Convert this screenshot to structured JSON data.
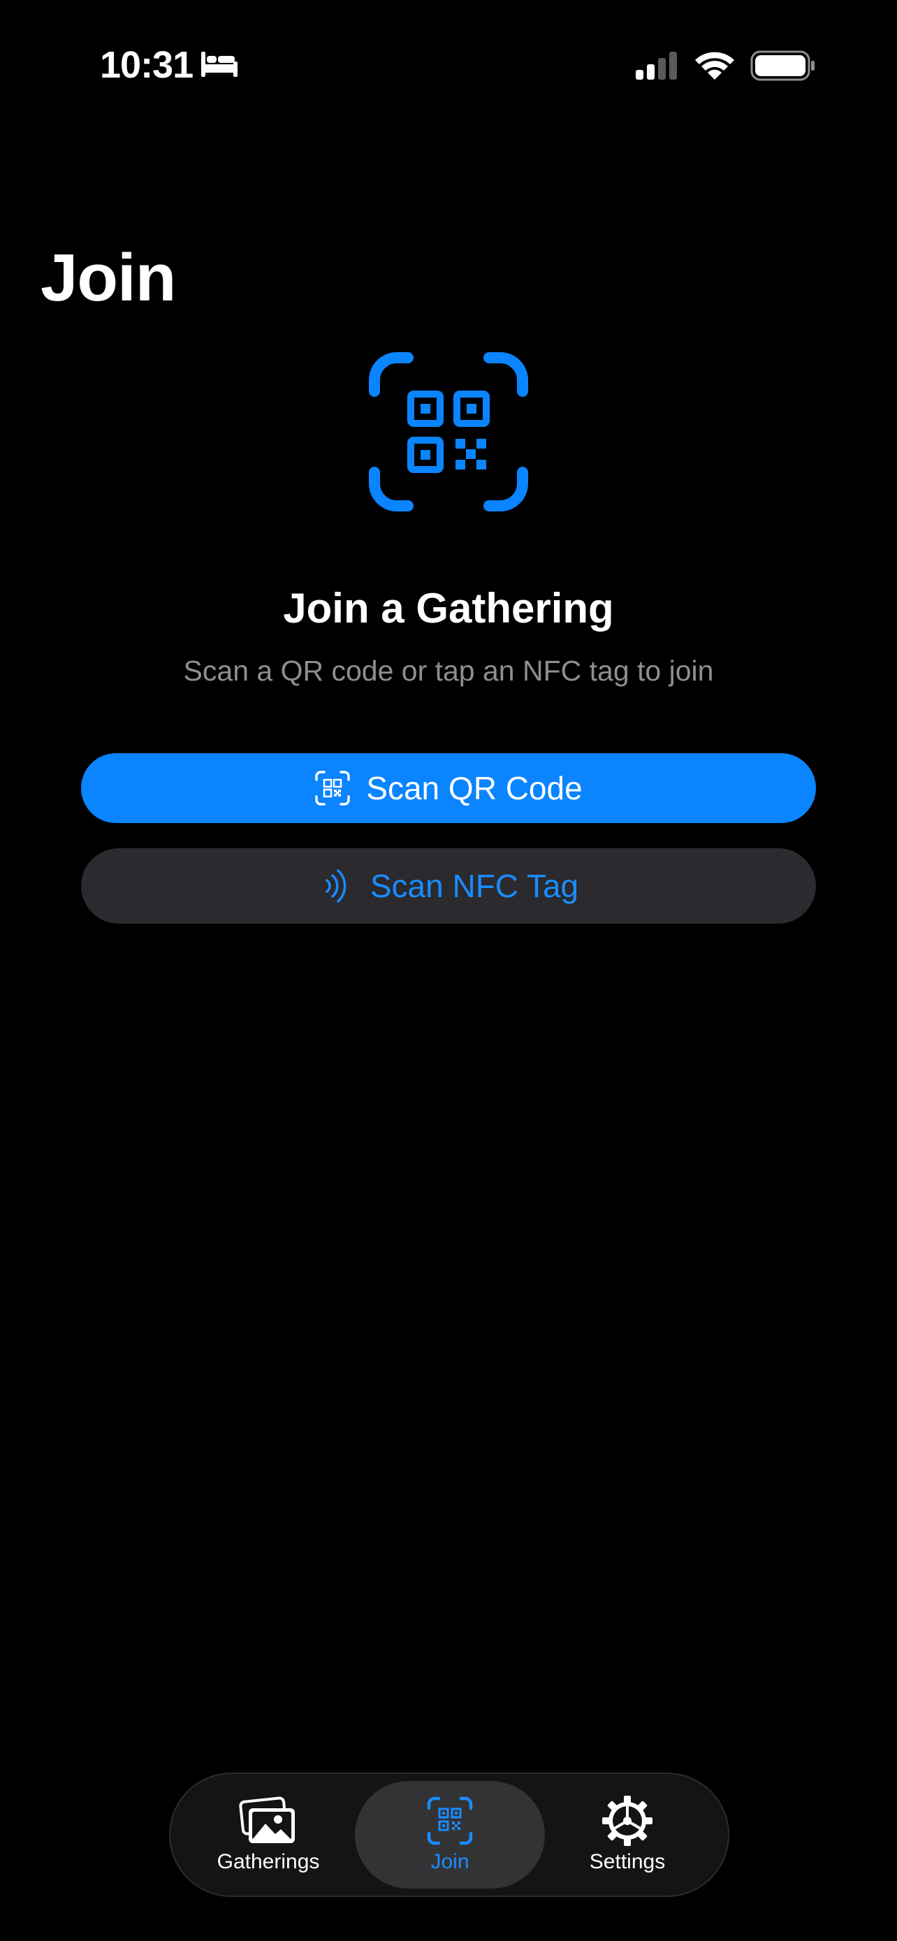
{
  "status_bar": {
    "time": "10:31",
    "icons": [
      "bed-icon",
      "cellular-signal-icon",
      "wifi-icon",
      "battery-icon"
    ]
  },
  "page": {
    "title": "Join"
  },
  "hero": {
    "icon": "qr-viewfinder-icon",
    "heading": "Join a Gathering",
    "subtitle": "Scan a QR code or tap an NFC tag to join"
  },
  "actions": {
    "scan_qr": {
      "label": "Scan QR Code",
      "icon": "qr-viewfinder-icon"
    },
    "scan_nfc": {
      "label": "Scan NFC Tag",
      "icon": "nfc-waves-icon"
    }
  },
  "tab_bar": {
    "tabs": [
      {
        "label": "Gatherings",
        "icon": "photo-stack-icon",
        "selected": false
      },
      {
        "label": "Join",
        "icon": "qr-viewfinder-icon",
        "selected": true
      },
      {
        "label": "Settings",
        "icon": "gear-icon",
        "selected": false
      }
    ]
  },
  "colors": {
    "accent": "#0A84FF",
    "background": "#000000",
    "secondary_button": "#2A2A2F",
    "secondary_text": "#8E8E93"
  }
}
